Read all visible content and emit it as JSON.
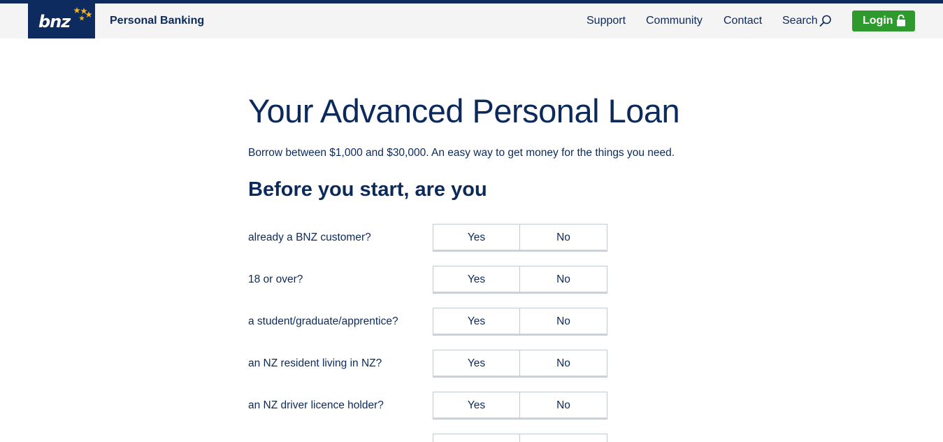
{
  "header": {
    "logo_text": "bnz",
    "brand_title": "Personal Banking",
    "nav": {
      "support": "Support",
      "community": "Community",
      "contact": "Contact",
      "search": "Search"
    },
    "login_label": "Login"
  },
  "colors": {
    "navy": "#0d2b5e",
    "text": "#0b2a5b",
    "login_green": "#2e9a2e",
    "star_gold": "#f5b21a"
  },
  "main": {
    "title": "Your Advanced Personal Loan",
    "lead": "Borrow between $1,000 and $30,000. An easy way to get money for the things you need.",
    "subhead": "Before you start, are you",
    "questions": [
      {
        "label": "already a BNZ customer?",
        "yes": "Yes",
        "no": "No"
      },
      {
        "label": "18 or over?",
        "yes": "Yes",
        "no": "No"
      },
      {
        "label": "a student/graduate/apprentice?",
        "yes": "Yes",
        "no": "No"
      },
      {
        "label": "an NZ resident living in NZ?",
        "yes": "Yes",
        "no": "No"
      },
      {
        "label": "an NZ driver licence holder?",
        "yes": "Yes",
        "no": "No"
      }
    ]
  }
}
